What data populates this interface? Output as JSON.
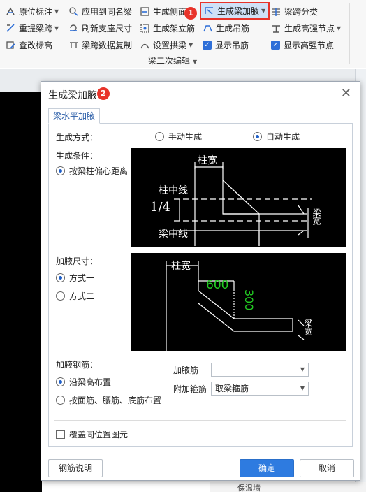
{
  "ribbon": {
    "col1": [
      {
        "label": "原位标注",
        "icon": "rebar-mark-icon",
        "dropdown": true
      },
      {
        "label": "重提梁跨",
        "icon": "beam-span-icon",
        "dropdown": true
      },
      {
        "label": "查改标高",
        "icon": "elevation-edit-icon",
        "dropdown": false
      }
    ],
    "col2": [
      {
        "label": "应用到同名梁",
        "icon": "apply-same-icon"
      },
      {
        "label": "刷新支座尺寸",
        "icon": "refresh-support-icon"
      },
      {
        "label": "梁跨数据复制",
        "icon": "copy-span-icon"
      }
    ],
    "col3": [
      {
        "label": "生成侧面",
        "icon": "side-rebar-icon",
        "dropdown": false
      },
      {
        "label": "生成架立筋",
        "icon": "erect-rebar-icon",
        "dropdown": false
      },
      {
        "label": "设置拱梁",
        "icon": "arch-beam-icon",
        "dropdown": true
      }
    ],
    "col4": [
      {
        "label": "生成梁加腋",
        "icon": "haunch-icon",
        "dropdown": true,
        "active": true
      },
      {
        "label": "生成吊筋",
        "icon": "hanger-icon",
        "dropdown": false
      },
      {
        "label": "显示吊筋",
        "checked": true
      }
    ],
    "col5": [
      {
        "label": "梁跨分类",
        "icon": "span-classify-icon",
        "dropdown": false
      },
      {
        "label": "生成高强节点",
        "icon": "high-strength-node-icon",
        "dropdown": true
      },
      {
        "label": "显示高强节点",
        "checked": true
      }
    ],
    "group_label": "梁二次编辑",
    "badge1": "1",
    "badge2": "2"
  },
  "dialog": {
    "title": "生成梁加腋",
    "tab": "梁水平加腋",
    "gen_mode_label": "生成方式：",
    "gen_mode_options": [
      "手动生成",
      "自动生成"
    ],
    "gen_mode_selected": 1,
    "gen_cond_label": "生成条件：",
    "gen_cond_option": "按梁柱偏心距离",
    "diagram1": {
      "col_width": "柱宽",
      "col_center": "柱中线",
      "ratio": "1/4",
      "beam_center": "梁中线",
      "beam_width": "梁宽"
    },
    "haunch_size_label": "加腋尺寸：",
    "haunch_size_options": [
      "方式一",
      "方式二"
    ],
    "haunch_size_selected": 0,
    "diagram2": {
      "col_width": "柱宽",
      "len": "600",
      "height": "300",
      "beam_width": "梁宽"
    },
    "haunch_rebar_label": "加腋钢筋：",
    "haunch_rebar_options": [
      "沿梁高布置",
      "按面筋、腰筋、底筋布置"
    ],
    "haunch_rebar_selected": 0,
    "rebar_field_label": "加腋筋",
    "rebar_field_value": "",
    "stirrup_field_label": "附加箍筋",
    "stirrup_field_value": "取梁箍筋",
    "overwrite_label": "覆盖同位置图元",
    "btn_help": "钢筋说明",
    "btn_ok": "确定",
    "btn_cancel": "取消"
  },
  "background": {
    "bottom_text": "保温墙"
  },
  "colors": {
    "accent": "#2e7be0",
    "highlight": "#e8332a",
    "diagram_green": "#22cc22"
  }
}
